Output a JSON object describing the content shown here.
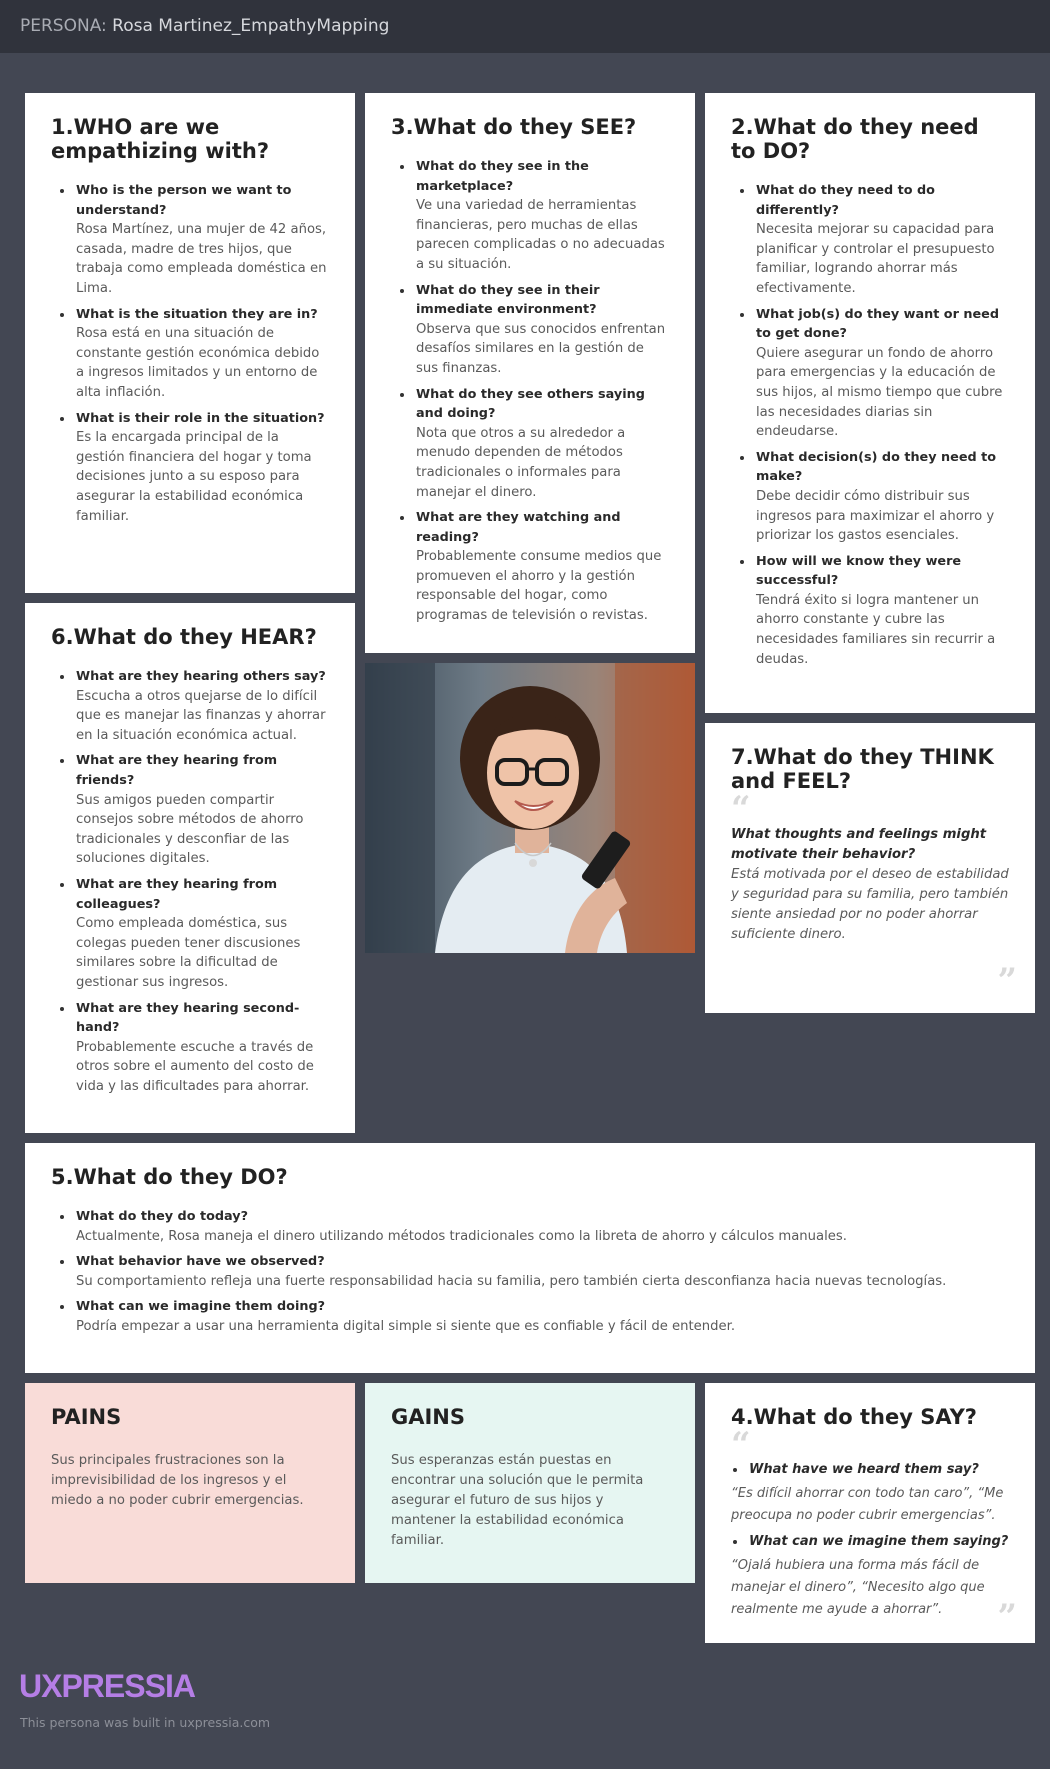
{
  "header": {
    "label": "PERSONA:",
    "name": "Rosa Martinez_EmpathyMapping"
  },
  "who": {
    "title": "1.WHO are we empathizing with?",
    "items": [
      {
        "q": "Who is the person we want to understand?",
        "a": "Rosa Martínez, una mujer de 42 años, casada, madre de tres hijos, que trabaja como empleada doméstica en Lima."
      },
      {
        "q": "What is the situation they are in?",
        "a": "Rosa está en una situación de constante gestión económica debido a ingresos limitados y un entorno de alta inflación."
      },
      {
        "q": "What is their role in the situation?",
        "a": "Es la encargada principal de la gestión financiera del hogar y toma decisiones junto a su esposo para asegurar la estabilidad económica familiar."
      }
    ]
  },
  "see": {
    "title": "3.What do they SEE?",
    "items": [
      {
        "q": "What do they see in the marketplace?",
        "a": "Ve una variedad de herramientas financieras, pero muchas de ellas parecen complicadas o no adecuadas a su situación."
      },
      {
        "q": "What do they see in their immediate environment?",
        "a": "Observa que sus conocidos enfrentan desafíos similares en la gestión de sus finanzas."
      },
      {
        "q": "What do they see others saying and doing?",
        "a": "Nota que otros a su alrededor a menudo dependen de métodos tradicionales o informales para manejar el dinero."
      },
      {
        "q": "What are they watching and reading?",
        "a": "Probablemente consume medios que promueven el ahorro y la gestión responsable del hogar, como programas de televisión o revistas."
      }
    ]
  },
  "do_need": {
    "title": "2.What do they need to DO?",
    "items": [
      {
        "q": "What do they need to do differently?",
        "a": "Necesita mejorar su capacidad para planificar y controlar el presupuesto familiar, logrando ahorrar más efectivamente."
      },
      {
        "q": "What job(s) do they want or need to get done?",
        "a": "Quiere asegurar un fondo de ahorro para emergencias y la educación de sus hijos, al mismo tiempo que cubre las necesidades diarias sin endeudarse."
      },
      {
        "q": "What decision(s) do they need to make?",
        "a": "Debe decidir cómo distribuir sus ingresos para maximizar el ahorro y priorizar los gastos esenciales."
      },
      {
        "q": "How will we know they were successful?",
        "a": "Tendrá éxito si logra mantener un ahorro constante y cubre las necesidades familiares sin recurrir a deudas."
      }
    ]
  },
  "hear": {
    "title": "6.What do they HEAR?",
    "items": [
      {
        "q": "What are they hearing others say?",
        "a": "Escucha a otros quejarse de lo difícil que es manejar las finanzas y ahorrar en la situación económica actual."
      },
      {
        "q": "What are they hearing from friends?",
        "a": "Sus amigos pueden compartir consejos sobre métodos de ahorro tradicionales y desconfiar de las soluciones digitales."
      },
      {
        "q": "What are they hearing from colleagues?",
        "a": "Como empleada doméstica, sus colegas pueden tener discusiones similares sobre la dificultad de gestionar sus ingresos."
      },
      {
        "q": "What are they hearing second-hand?",
        "a": "Probablemente escuche a través de otros sobre el aumento del costo de vida y las dificultades para ahorrar."
      }
    ]
  },
  "think": {
    "title": "7.What do they THINK and FEEL?",
    "q": "What thoughts and feelings might motivate their behavior?",
    "a": "Está motivada por el deseo de estabilidad y seguridad para su familia, pero también siente ansiedad por no poder ahorrar suficiente dinero."
  },
  "do_now": {
    "title": "5.What do they DO?",
    "items": [
      {
        "q": "What do they do today?",
        "a": "Actualmente, Rosa maneja el dinero utilizando métodos tradicionales como la libreta de ahorro y cálculos manuales."
      },
      {
        "q": "What behavior have we observed?",
        "a": "Su comportamiento refleja una fuerte responsabilidad hacia su familia, pero también cierta desconfianza hacia nuevas tecnologías."
      },
      {
        "q": "What can we imagine them doing?",
        "a": "Podría empezar a usar una herramienta digital simple si siente que es confiable y fácil de entender."
      }
    ]
  },
  "pains": {
    "title": "PAINS",
    "text": "Sus principales frustraciones son la imprevisibilidad de los ingresos y el miedo a no poder cubrir emergencias."
  },
  "gains": {
    "title": "GAINS",
    "text": "Sus esperanzas están puestas en encontrar una solución que le permita asegurar el futuro de sus hijos y mantener la estabilidad económica familiar."
  },
  "say": {
    "title": "4.What do they SAY?",
    "items": [
      {
        "q": "What have we heard them say?",
        "a": "“Es difícil ahorrar con todo tan caro”, “Me preocupa no poder cubrir emergencias”."
      },
      {
        "q": "What can we imagine them saying?",
        "a": "“Ojalá hubiera una forma más fácil de manejar el dinero”, “Necesito algo que realmente me ayude a ahorrar”."
      }
    ]
  },
  "footer": {
    "logo": "UXPRESSIA",
    "note": "This persona was built in uxpressia.com"
  },
  "colors": {
    "background": "#434753",
    "topbar": "#30333c",
    "pains_bg": "#f9dcd8",
    "gains_bg": "#e6f6f2",
    "logo": "#b57ee5"
  },
  "icons": [
    "quote-open-icon",
    "quote-close-icon"
  ]
}
